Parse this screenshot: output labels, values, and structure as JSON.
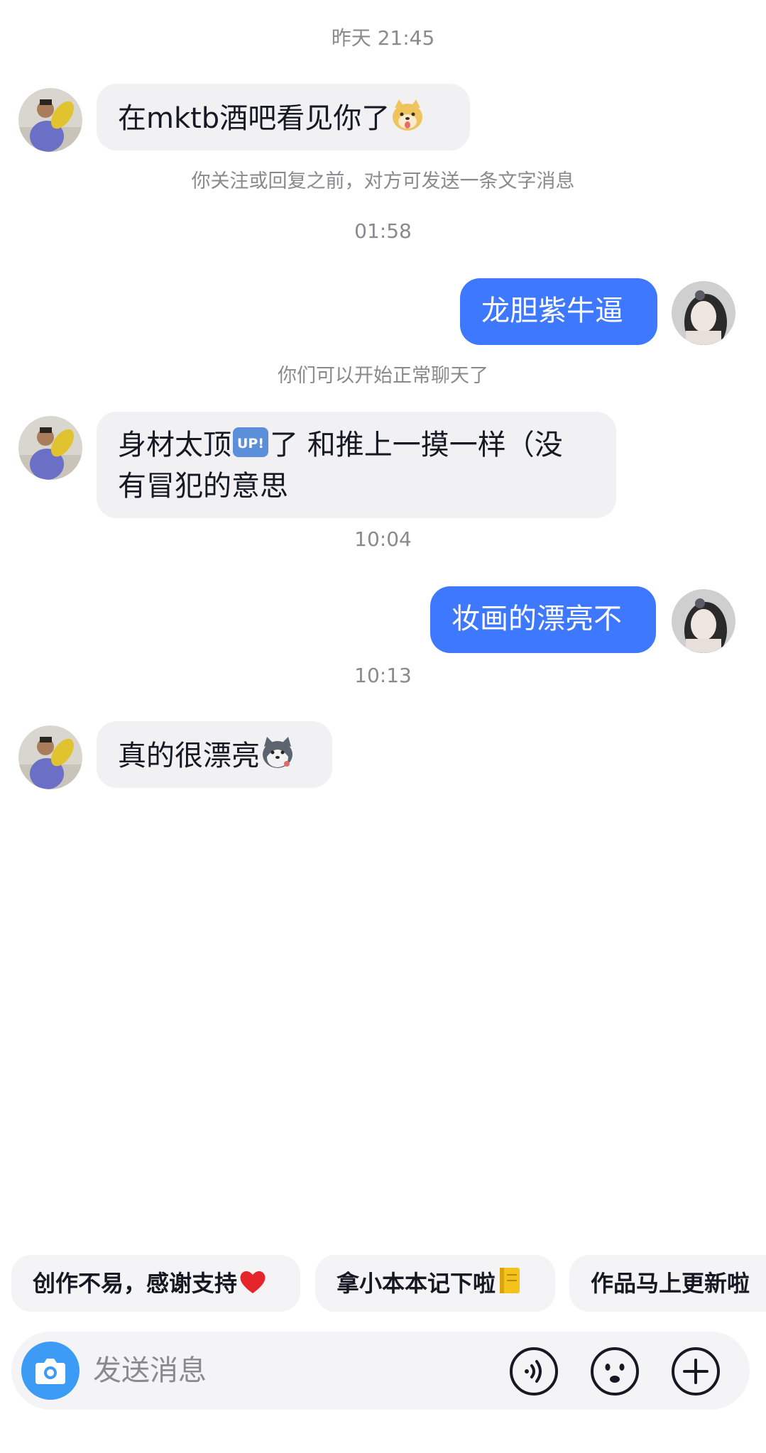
{
  "messages": {
    "time1": "昨天 21:45",
    "msg1": "在mktb酒吧看见你了",
    "notice1": "你关注或回复之前，对方可发送一条文字消息",
    "time2": "01:58",
    "msg2": "龙胆紫牛逼",
    "notice2": "你们可以开始正常聊天了",
    "msg3_line1": "身材太顶",
    "msg3_line1b": "了 和推上一摸一样（没",
    "msg3_line2": "有冒犯的意思",
    "msg3_badge": "UP!",
    "time3": "10:04",
    "msg4": "妆画的漂亮不",
    "time4": "10:13",
    "msg5": "真的很漂亮"
  },
  "quick_replies": {
    "chip1": "创作不易，感谢支持",
    "chip2": "拿小本本记下啦",
    "chip3": "作品马上更新啦"
  },
  "input": {
    "placeholder": "发送消息"
  },
  "icons": {
    "camera": "camera-icon",
    "voice": "voice-icon",
    "emoji": "emoji-icon",
    "plus": "plus-icon"
  },
  "colors": {
    "outgoing_bubble": "#3e78ff",
    "incoming_bubble": "#f1f1f4",
    "camera_button": "#3b9bf5"
  }
}
